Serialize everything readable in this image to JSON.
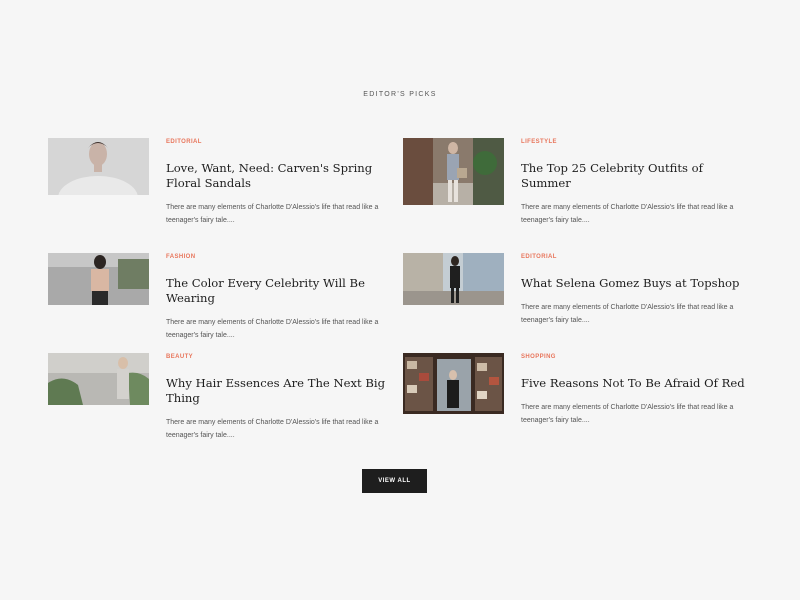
{
  "section": {
    "title": "EDITOR'S PICKS"
  },
  "articles": [
    {
      "category": "EDITORIAL",
      "title": "Love, Want, Need: Carven's Spring Floral Sandals",
      "excerpt": "There are many elements of Charlotte D'Alessio's life that read like a teenager's fairy tale....",
      "image": "portrait-woman-floral-image"
    },
    {
      "category": "LIFESTYLE",
      "title": "The Top 25 Celebrity Outfits of Summer",
      "excerpt": "There are many elements of Charlotte D'Alessio's life that read like a teenager's fairy tale....",
      "image": "street-style-woman-image"
    },
    {
      "category": "FASHION",
      "title": "The Color Every Celebrity Will Be Wearing",
      "excerpt": "There are many elements of Charlotte D'Alessio's life that read like a teenager's fairy tale....",
      "image": "woman-back-view-image"
    },
    {
      "category": "EDITORIAL",
      "title": "What Selena Gomez Buys at Topshop",
      "excerpt": "There are many elements of Charlotte D'Alessio's life that read like a teenager's fairy tale....",
      "image": "woman-walking-street-image"
    },
    {
      "category": "BEAUTY",
      "title": "Why Hair Essences Are The Next Big Thing",
      "excerpt": "There are many elements of Charlotte D'Alessio's life that read like a teenager's fairy tale....",
      "image": "woman-white-dress-image"
    },
    {
      "category": "SHOPPING",
      "title": "Five Reasons Not To Be Afraid Of Red",
      "excerpt": "There are many elements of Charlotte D'Alessio's life that read like a teenager's fairy tale....",
      "image": "boutique-shelves-image"
    }
  ],
  "actions": {
    "view_all_label": "VIEW ALL"
  },
  "colors": {
    "background": "#f6f6f6",
    "category_accent": "#e8765c",
    "button_bg": "#1e1e1e"
  }
}
